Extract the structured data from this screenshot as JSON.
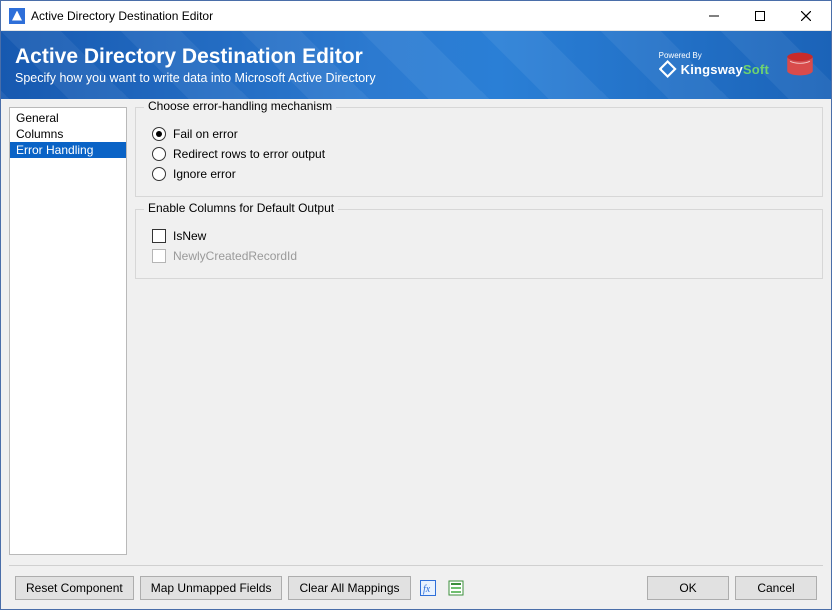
{
  "window": {
    "title": "Active Directory Destination Editor"
  },
  "header": {
    "heading": "Active Directory Destination Editor",
    "subheading": "Specify how you want to write data into Microsoft Active Directory",
    "poweredBy": "Powered By",
    "brandA": "Kingsway",
    "brandB": "Soft"
  },
  "nav": {
    "items": [
      {
        "label": "General",
        "selected": false
      },
      {
        "label": "Columns",
        "selected": false
      },
      {
        "label": "Error Handling",
        "selected": true
      }
    ]
  },
  "errorGroup": {
    "title": "Choose error-handling mechanism",
    "options": [
      {
        "label": "Fail on error",
        "checked": true
      },
      {
        "label": "Redirect rows to error output",
        "checked": false
      },
      {
        "label": "Ignore error",
        "checked": false
      }
    ]
  },
  "outputGroup": {
    "title": "Enable Columns for Default Output",
    "items": [
      {
        "label": "IsNew",
        "checked": false,
        "disabled": false
      },
      {
        "label": "NewlyCreatedRecordId",
        "checked": false,
        "disabled": true
      }
    ]
  },
  "footer": {
    "reset": "Reset Component",
    "mapUnmapped": "Map Unmapped Fields",
    "clearAll": "Clear All Mappings",
    "ok": "OK",
    "cancel": "Cancel"
  }
}
